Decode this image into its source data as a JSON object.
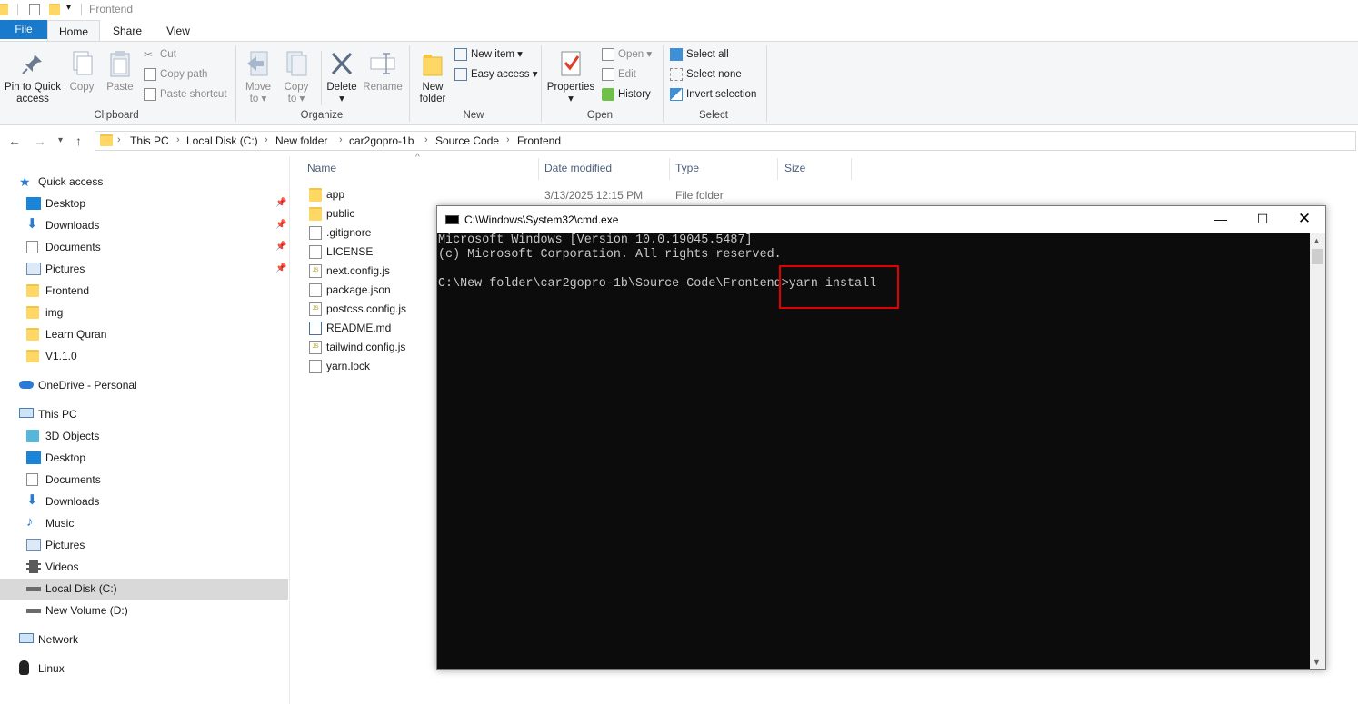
{
  "window": {
    "title": "Frontend"
  },
  "ribbon": {
    "tabs": [
      {
        "label": "File"
      },
      {
        "label": "Home"
      },
      {
        "label": "Share"
      },
      {
        "label": "View"
      }
    ],
    "clipboard": {
      "label": "Clipboard",
      "pin_label_1": "Pin to Quick",
      "pin_label_2": "access",
      "copy": "Copy",
      "paste": "Paste",
      "cut": "Cut",
      "copy_path": "Copy path",
      "paste_shortcut": "Paste shortcut"
    },
    "organize": {
      "label": "Organize",
      "move_1": "Move",
      "move_2": "to",
      "copy_1": "Copy",
      "copy_2": "to",
      "delete": "Delete",
      "rename": "Rename"
    },
    "new": {
      "label": "New",
      "new_folder_1": "New",
      "new_folder_2": "folder",
      "new_item": "New item",
      "easy_access": "Easy access"
    },
    "open": {
      "label": "Open",
      "properties": "Properties",
      "open": "Open",
      "edit": "Edit",
      "history": "History"
    },
    "select": {
      "label": "Select",
      "select_all": "Select all",
      "select_none": "Select none",
      "invert": "Invert selection"
    }
  },
  "address": {
    "crumbs": [
      "This PC",
      "Local Disk (C:)",
      "New folder",
      "car2gopro-1b",
      "Source Code",
      "Frontend"
    ]
  },
  "sidebar": {
    "quick_access": "Quick access",
    "quick_items": [
      "Desktop",
      "Downloads",
      "Documents",
      "Pictures",
      "Frontend",
      "img",
      "Learn Quran",
      "V1.1.0"
    ],
    "onedrive": "OneDrive - Personal",
    "this_pc": "This PC",
    "pc_items": [
      "3D Objects",
      "Desktop",
      "Documents",
      "Downloads",
      "Music",
      "Pictures",
      "Videos",
      "Local Disk (C:)",
      "New Volume (D:)"
    ],
    "network": "Network",
    "linux": "Linux"
  },
  "filelist": {
    "columns": [
      "Name",
      "Date modified",
      "Type",
      "Size"
    ],
    "files": [
      {
        "name": "app",
        "date": "3/13/2025 12:15 PM",
        "type": "File folder"
      },
      {
        "name": "public"
      },
      {
        "name": ".gitignore"
      },
      {
        "name": "LICENSE"
      },
      {
        "name": "next.config.js"
      },
      {
        "name": "package.json"
      },
      {
        "name": "postcss.config.js"
      },
      {
        "name": "README.md"
      },
      {
        "name": "tailwind.config.js"
      },
      {
        "name": "yarn.lock"
      }
    ]
  },
  "cmd": {
    "title": "C:\\Windows\\System32\\cmd.exe",
    "lines": [
      "Microsoft Windows [Version 10.0.19045.5487]",
      "(c) Microsoft Corporation. All rights reserved.",
      "",
      "C:\\New folder\\car2gopro-1b\\Source Code\\Frontend>yarn install"
    ]
  },
  "colors": {
    "accent": "#1979ca",
    "highlight": "#e00000",
    "console_bg": "#0c0c0c"
  }
}
